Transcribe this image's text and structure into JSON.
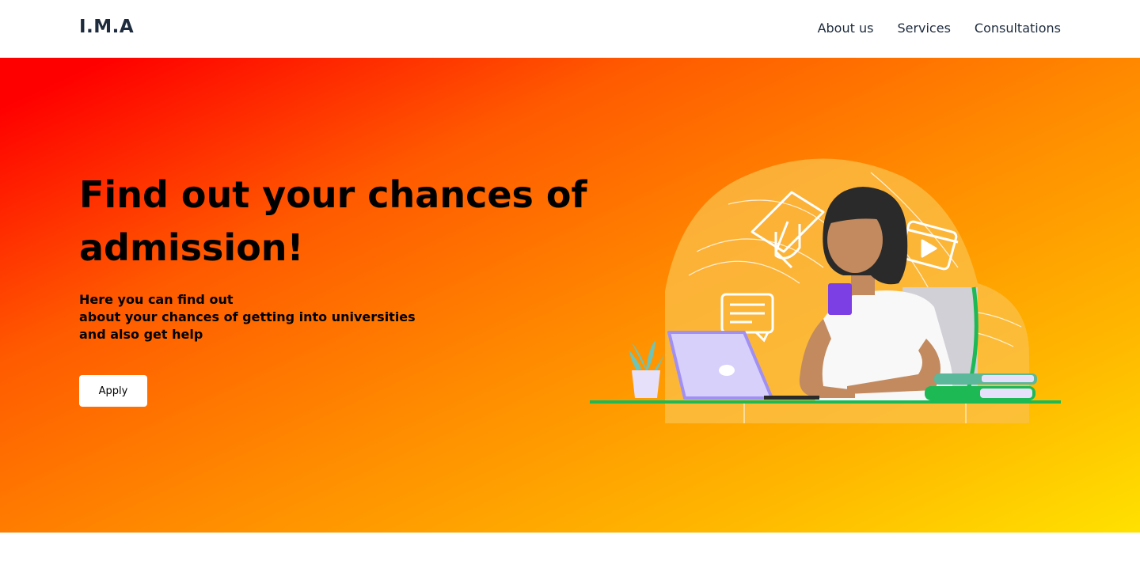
{
  "header": {
    "logo": "I.M.A",
    "nav": [
      "About us",
      "Services",
      "Consultations"
    ]
  },
  "hero": {
    "title": "Find out your chances of admission!",
    "subtitle_lines": [
      "Here you can find out",
      "about your chances of getting into universities",
      "and also get help"
    ],
    "apply_label": "Apply"
  },
  "colors": {
    "gradient_start": "#ff0000",
    "gradient_end": "#ffe100",
    "text_dark": "#1d2b3d",
    "desk_green": "#1db954",
    "laptop_lilac": "#d7d0fb"
  },
  "icons": [
    "graduation-cap-icon",
    "video-icon",
    "chat-icon",
    "plant-icon",
    "laptop-icon",
    "books-icon"
  ]
}
